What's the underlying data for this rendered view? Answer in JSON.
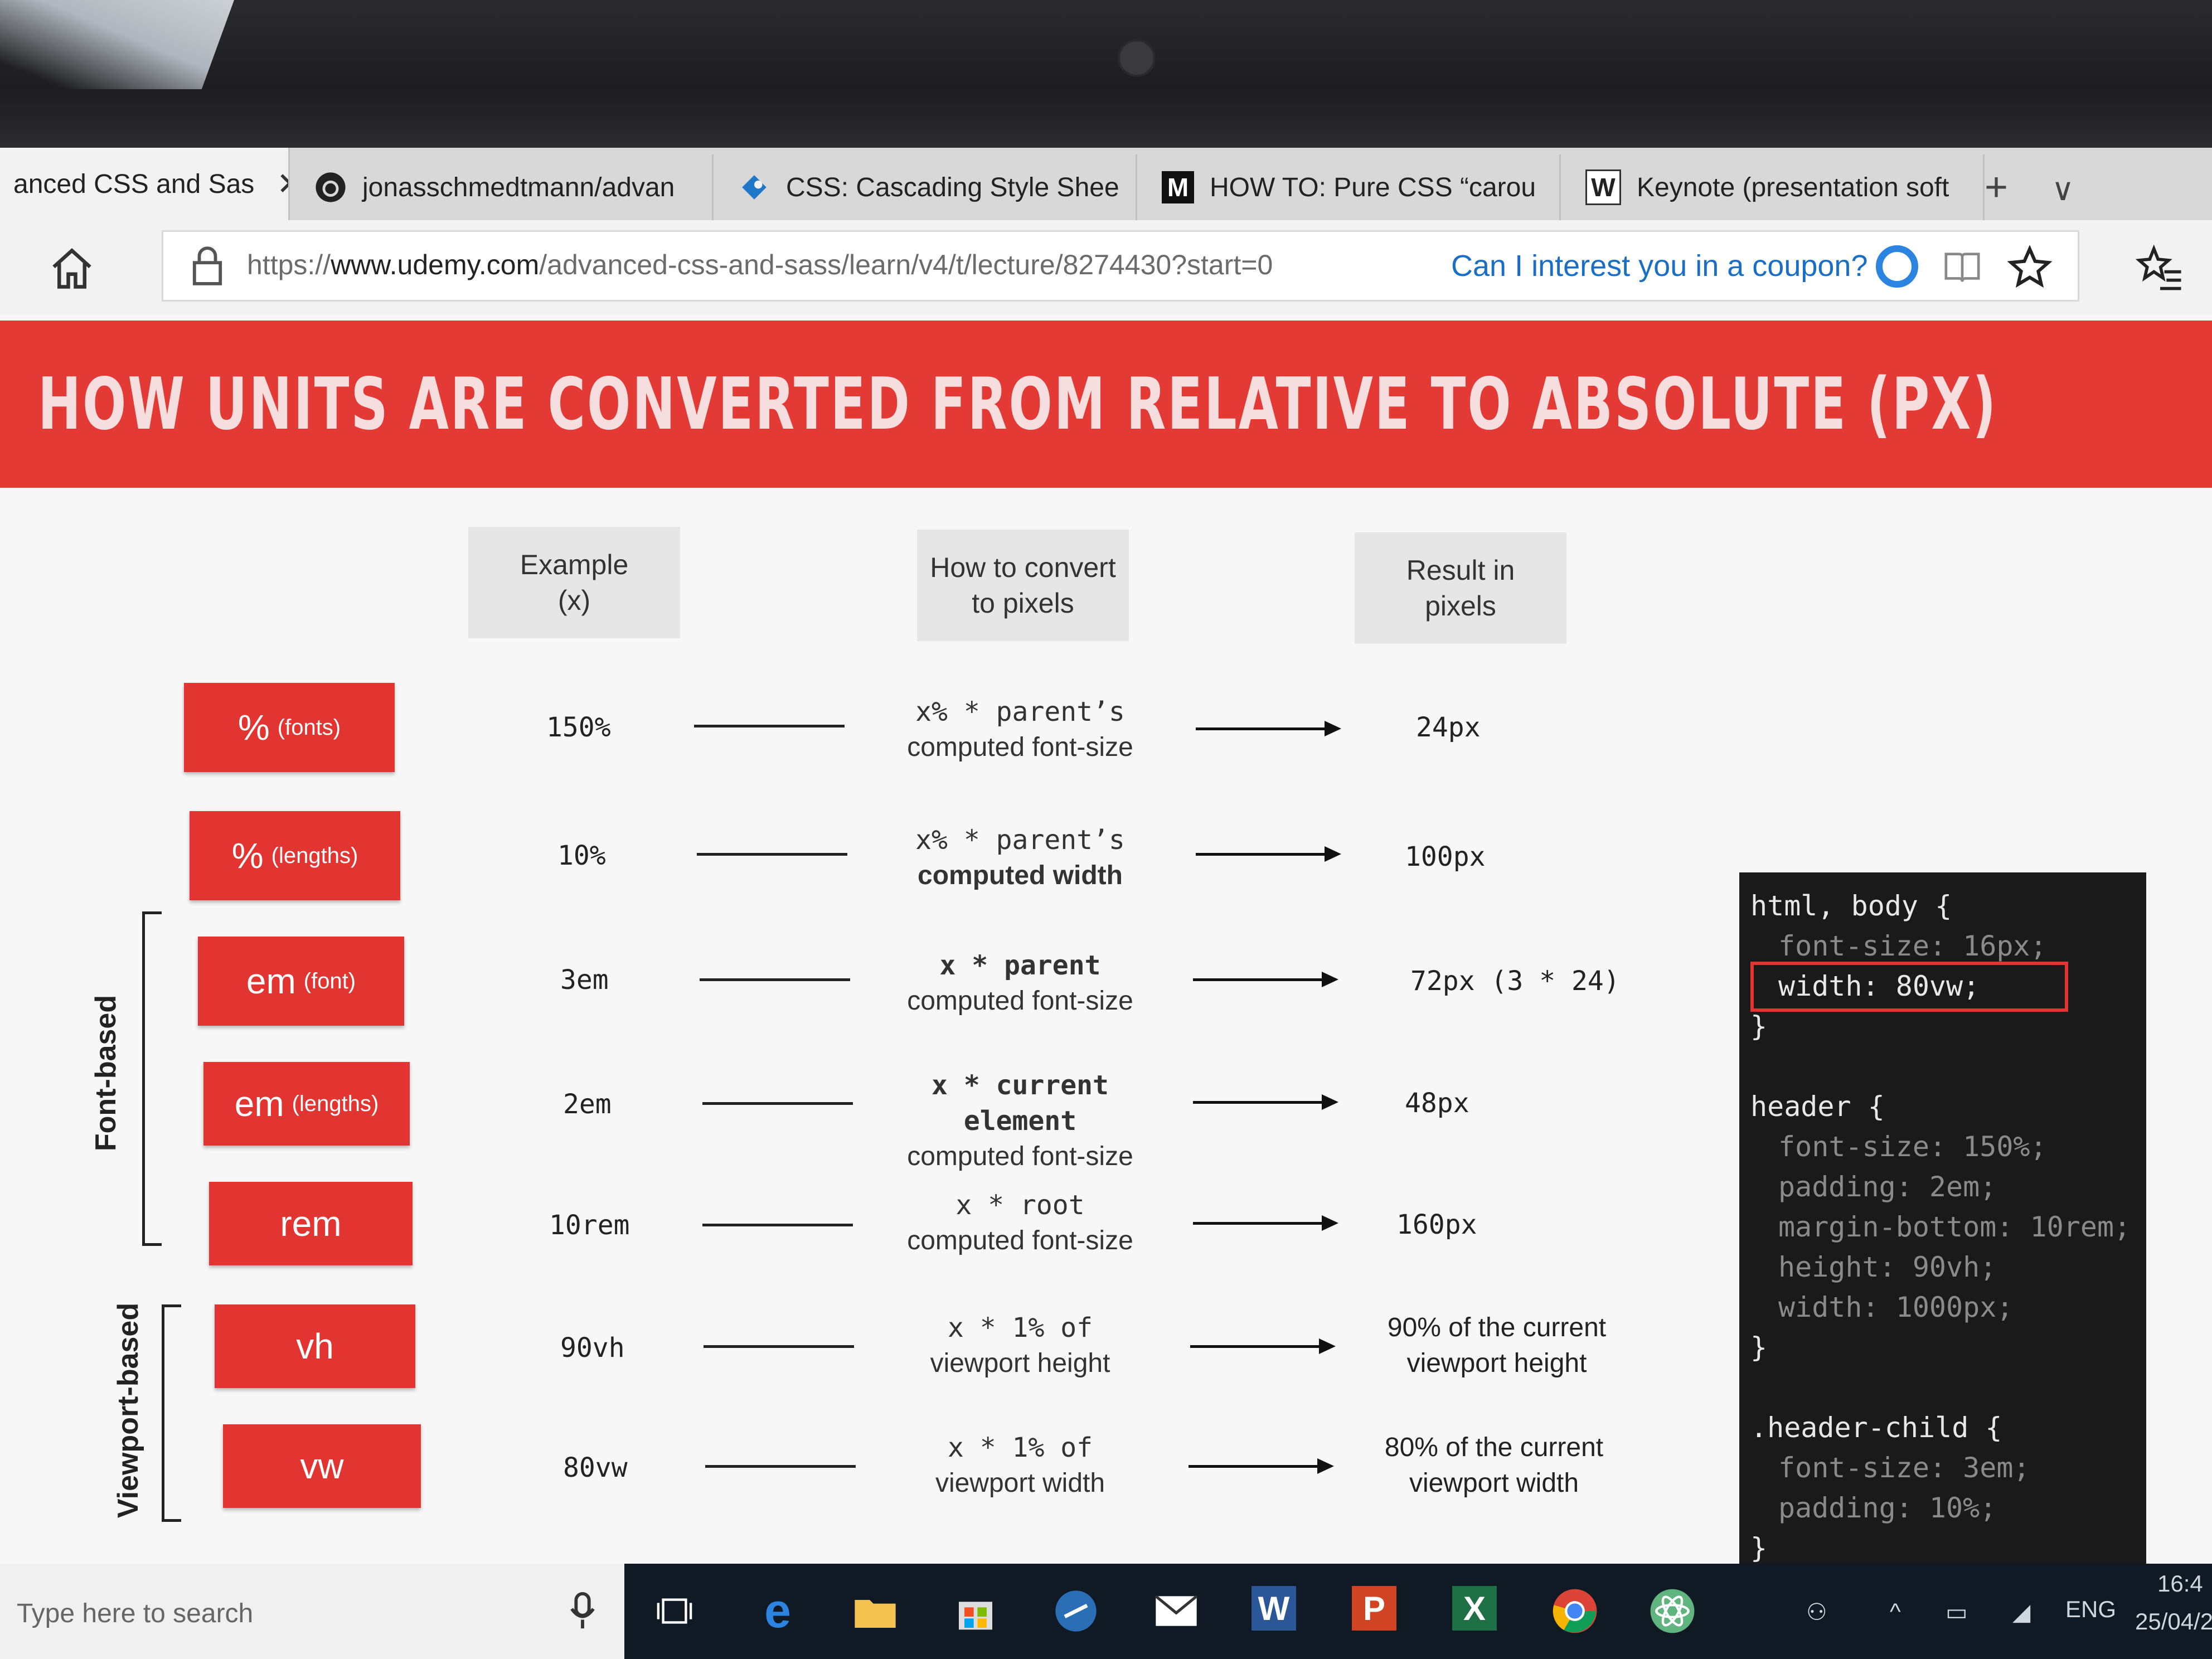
{
  "browser": {
    "tabs": [
      {
        "label": "anced CSS and Sas",
        "icon": "udemy-icon",
        "active": true
      },
      {
        "label": "jonasschmedtmann/advan",
        "icon": "github-icon"
      },
      {
        "label": "CSS: Cascading Style Shee",
        "icon": "mdn-icon"
      },
      {
        "label": "HOW TO: Pure CSS “carou",
        "icon": "medium-icon"
      },
      {
        "label": "Keynote (presentation soft",
        "icon": "wikipedia-icon"
      }
    ],
    "new_tab_symbol": "+",
    "tab_menu_symbol": "∨",
    "url_prefix": "https://",
    "url_domain": "www.udemy.com",
    "url_path": "/advanced-css-and-sass/learn/v4/t/lecture/8274430?start=0",
    "coupon_text": "Can I interest you in a coupon?"
  },
  "slide": {
    "title": "HOW UNITS ARE CONVERTED FROM RELATIVE TO ABSOLUTE (PX)",
    "headers": {
      "example": [
        "Example",
        "(x)"
      ],
      "how": [
        "How to convert",
        "to pixels"
      ],
      "result": [
        "Result in",
        "pixels"
      ]
    },
    "rows": [
      {
        "unit": "%",
        "unit_note": "(fonts)",
        "example": "150%",
        "how1": "x%  *  parent’s",
        "how2": "computed font-size",
        "result1": "24px",
        "result2": ""
      },
      {
        "unit": "%",
        "unit_note": "(lengths)",
        "example": "10%",
        "how1": "x%  *  parent’s",
        "how2": "computed width",
        "result1": "100px",
        "result2": ""
      },
      {
        "unit": "em",
        "unit_note": "(font)",
        "example": "3em",
        "how1": "x  *  parent",
        "how2": "computed font-size",
        "result1": "72px (3 * 24)",
        "result2": ""
      },
      {
        "unit": "em",
        "unit_note": "(lengths)",
        "example": "2em",
        "how1": "x  *  current element",
        "how2": "computed font-size",
        "result1": "48px",
        "result2": ""
      },
      {
        "unit": "rem",
        "unit_note": "",
        "example": "10rem",
        "how1": "x * root",
        "how2": "computed font-size",
        "result1": "160px",
        "result2": ""
      },
      {
        "unit": "vh",
        "unit_note": "",
        "example": "90vh",
        "how1": "x * 1% of",
        "how2": "viewport height",
        "result1": "90% of the current",
        "result2": "viewport height"
      },
      {
        "unit": "vw",
        "unit_note": "",
        "example": "80vw",
        "how1": "x * 1% of",
        "how2": "viewport width",
        "result1": "80% of the current",
        "result2": "viewport width"
      }
    ],
    "group_font": "Font-based",
    "group_viewport": "Viewport-based"
  },
  "code": {
    "lines": [
      {
        "t": "html, body {",
        "cls": "sel",
        "indent": 0
      },
      {
        "t": "font-size: 16px;",
        "cls": "prop",
        "indent": 1
      },
      {
        "t": "width: 80vw;",
        "cls": "hl",
        "indent": 1
      },
      {
        "t": "}",
        "cls": "sel",
        "indent": 0
      },
      {
        "t": "",
        "cls": "sel",
        "indent": 0
      },
      {
        "t": "header {",
        "cls": "sel",
        "indent": 0
      },
      {
        "t": "font-size: 150%;",
        "cls": "prop",
        "indent": 1
      },
      {
        "t": "padding: 2em;",
        "cls": "prop",
        "indent": 1
      },
      {
        "t": "margin-bottom: 10rem;",
        "cls": "prop",
        "indent": 1
      },
      {
        "t": "height: 90vh;",
        "cls": "prop",
        "indent": 1
      },
      {
        "t": "width: 1000px;",
        "cls": "prop",
        "indent": 1
      },
      {
        "t": "}",
        "cls": "sel",
        "indent": 0
      },
      {
        "t": "",
        "cls": "sel",
        "indent": 0
      },
      {
        "t": ".header-child {",
        "cls": "sel",
        "indent": 0
      },
      {
        "t": "font-size: 3em;",
        "cls": "prop",
        "indent": 1
      },
      {
        "t": "padding: 10%;",
        "cls": "prop",
        "indent": 1
      },
      {
        "t": "}",
        "cls": "sel",
        "indent": 0
      }
    ]
  },
  "taskbar": {
    "search_placeholder": "Type here to search",
    "lang": "ENG",
    "time": "16:4",
    "date": "25/04/2",
    "apps": [
      "task-view-icon",
      "edge-icon",
      "file-explorer-icon",
      "store-icon",
      "app-icon",
      "mail-icon",
      "word-icon",
      "powerpoint-icon",
      "excel-icon",
      "chrome-icon",
      "atom-icon"
    ]
  },
  "colors": {
    "accent_red": "#e43a36",
    "code_bg": "#1a1a1a",
    "link_blue": "#1a6fc5"
  }
}
